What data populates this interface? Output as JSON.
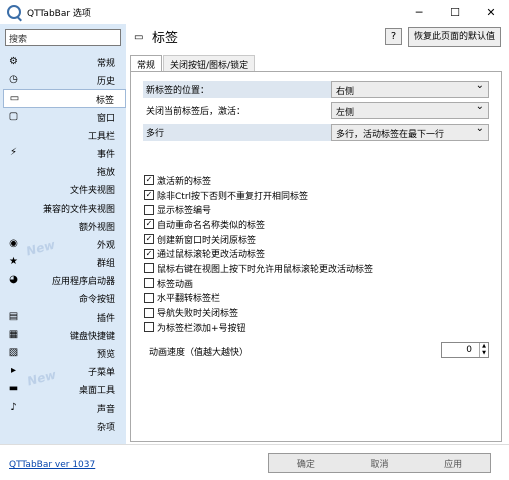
{
  "window": {
    "title": "QTTabBar 选项",
    "minimize_icon": "─",
    "maximize_icon": "☐",
    "close_icon": "✕"
  },
  "search": {
    "placeholder": "搜索"
  },
  "nav": [
    {
      "label": "常规",
      "icon": "⚙"
    },
    {
      "label": "历史",
      "icon": "◷"
    },
    {
      "label": "标签",
      "icon": "▭"
    },
    {
      "label": "窗口",
      "icon": "▢"
    },
    {
      "label": "工具栏",
      "icon": ""
    },
    {
      "label": "事件",
      "icon": "⚡"
    },
    {
      "label": "拖放",
      "icon": ""
    },
    {
      "label": "文件夹视图",
      "icon": ""
    },
    {
      "label": "兼容的文件夹视图",
      "icon": ""
    },
    {
      "label": "额外视图",
      "icon": ""
    },
    {
      "label": "外观",
      "icon": "◉"
    },
    {
      "label": "群组",
      "icon": "★"
    },
    {
      "label": "应用程序启动器",
      "icon": "◕"
    },
    {
      "label": "命令按钮",
      "icon": ""
    },
    {
      "label": "插件",
      "icon": "▤"
    },
    {
      "label": "键盘快捷键",
      "icon": "▦"
    },
    {
      "label": "预览",
      "icon": "▧"
    },
    {
      "label": "子菜单",
      "icon": "▸"
    },
    {
      "label": "桌面工具",
      "icon": "▬"
    },
    {
      "label": "声音",
      "icon": "♪"
    },
    {
      "label": "杂项",
      "icon": ""
    }
  ],
  "nav_selected": 2,
  "watermarks": {
    "new1": "New",
    "new2": "New"
  },
  "header": {
    "icon": "▭",
    "title": "标签",
    "help": "?",
    "restore": "恢复此页面的默认值"
  },
  "tabs": [
    "常规",
    "关闭按钮/图标/锁定"
  ],
  "settings": [
    {
      "label": "新标签的位置：",
      "value": "右侧"
    },
    {
      "label": "关闭当前标签后，激活：",
      "value": "左侧"
    },
    {
      "label": "多行",
      "value": "多行，活动标签在最下一行"
    }
  ],
  "checkboxes": [
    {
      "label": "激活新的标签",
      "checked": true
    },
    {
      "label": "除非Ctrl按下否则不重复打开相同标签",
      "checked": true
    },
    {
      "label": "显示标签编号",
      "checked": false
    },
    {
      "label": "自动重命名名称类似的标签",
      "checked": true
    },
    {
      "label": "创建新窗口时关闭原标签",
      "checked": true
    },
    {
      "label": "通过鼠标滚轮更改活动标签",
      "checked": true
    },
    {
      "label": "鼠标右键在视图上按下时允许用鼠标滚轮更改活动标签",
      "checked": false
    },
    {
      "label": "标签动画",
      "checked": false
    },
    {
      "label": "水平翻转标签栏",
      "checked": false
    },
    {
      "label": "导航失败时关闭标签",
      "checked": false
    },
    {
      "label": "为标签栏添加+号按钮",
      "checked": false
    }
  ],
  "check_mark": "✓",
  "speed": {
    "label": "动画速度（值越大越快）",
    "value": "0",
    "up": "▲",
    "down": "▼"
  },
  "footer": {
    "version": "QTTabBar ver 1037",
    "ok": "确定",
    "cancel": "取消",
    "apply": "应用"
  }
}
